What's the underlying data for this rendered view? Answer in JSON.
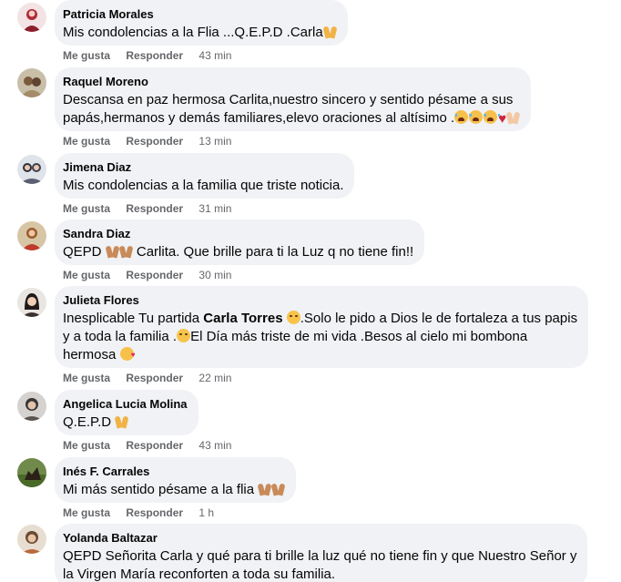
{
  "actions": {
    "like": "Me gusta",
    "reply": "Responder"
  },
  "comments": [
    {
      "author": "Patricia Morales",
      "text": "Mis condolencias a la Flia ...Q.E.P.D .Carla",
      "time": "43 min"
    },
    {
      "author": "Raquel Moreno",
      "text_line1": "Descansa en paz hermosa Carlita,nuestro sincero y sentido pésame a sus",
      "text_line2": "papás,hermanos y demás familiares,elevo oraciones al altísimo .",
      "time": "13 min"
    },
    {
      "author": "Jimena Diaz",
      "text": "Mis condolencias a la familia que triste noticia.",
      "time": "31 min"
    },
    {
      "author": "Sandra Diaz",
      "text_a": "QEPD",
      "text_b": "Carlita. Que brille para ti la Luz q no tiene fin!!",
      "time": "30 min"
    },
    {
      "author": "Julieta Flores",
      "text_a": "Inesplicable Tu partida",
      "mention": "Carla Torres",
      "text_b": ".Solo le pido a Dios le de fortaleza a tus papis",
      "text_c": "y a toda la familia .",
      "text_d": "El Día más triste de mi vida .Besos al cielo mi bombona",
      "text_e": "hermosa",
      "time": "22 min"
    },
    {
      "author": "Angelica Lucia Molina",
      "text": "Q.E.P.D",
      "time": "43 min"
    },
    {
      "author": "Inés F. Carrales",
      "text": "Mi más sentido pésame a la flia",
      "time": "1 h"
    },
    {
      "author": "Yolanda Baltazar",
      "text_line1": "QEPD Señorita Carla y qué para ti brille la luz qué no tiene fin y que Nuestro Señor y",
      "text_line2": "la Virgen María reconforten a toda su familia."
    }
  ]
}
